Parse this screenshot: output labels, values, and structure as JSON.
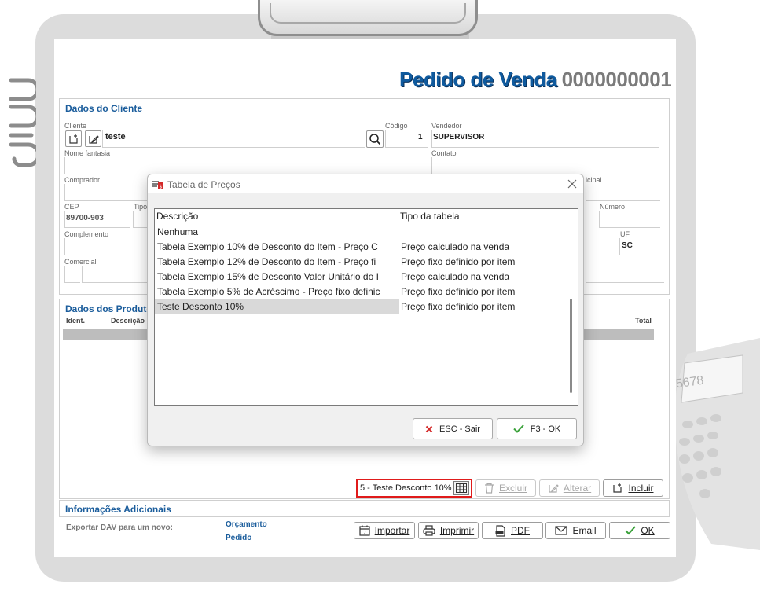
{
  "header": {
    "title": "Pedido de Venda",
    "order_number": "0000000001"
  },
  "cliente_section": {
    "title": "Dados do Cliente",
    "labels": {
      "cliente": "Cliente",
      "codigo": "Código",
      "vendedor": "Vendedor",
      "nome_fantasia": "Nome fantasia",
      "contato": "Contato",
      "comprador": "Comprador",
      "municipal": "icipal",
      "cep": "CEP",
      "tipo": "Tipo",
      "numero": "Número",
      "complemento": "Complemento",
      "uf": "UF",
      "comercial": "Comercial"
    },
    "values": {
      "cliente": "teste",
      "codigo": "1",
      "vendedor": "SUPERVISOR",
      "cep": "89700-903",
      "uf": "SC"
    }
  },
  "produtos_section": {
    "title": "Dados dos Produto",
    "columns": {
      "ident": "Ident.",
      "descricao": "Descrição",
      "total": "Total"
    }
  },
  "product_toolbar": {
    "selected_table": "5 - Teste Desconto 10%",
    "excluir": "Excluir",
    "alterar": "Alterar",
    "incluir": "Incluir"
  },
  "info_section": {
    "title": "Informações Adicionais",
    "export_label": "Exportar DAV para um novo:",
    "orcamento": "Orçamento",
    "pedido": "Pedido"
  },
  "footer_buttons": {
    "importar": "Importar",
    "imprimir": "Imprimir",
    "pdf": "PDF",
    "email": "Email",
    "ok": "OK"
  },
  "dialog": {
    "title": "Tabela de Preços",
    "columns": {
      "descricao": "Descrição",
      "tipo": "Tipo da tabela"
    },
    "rows": [
      {
        "descricao": "Nenhuma",
        "tipo": ""
      },
      {
        "descricao": "Tabela Exemplo 10% de Desconto do Item - Preço C",
        "tipo": "Preço calculado na venda"
      },
      {
        "descricao": "Tabela Exemplo 12% de Desconto do Item - Preço fi",
        "tipo": "Preço fixo definido por item"
      },
      {
        "descricao": "Tabela Exemplo 15% de Desconto Valor Unitário do I",
        "tipo": "Preço calculado na venda"
      },
      {
        "descricao": "Tabela Exemplo 5% de Acréscimo - Preço fixo definic",
        "tipo": "Preço fixo definido por item"
      },
      {
        "descricao": "Teste Desconto 10%",
        "tipo": "Preço fixo definido por item"
      }
    ],
    "selected_row": 5,
    "esc_label": "ESC - Sair",
    "ok_label": "F3 - OK"
  },
  "calculator_display": "5678",
  "colors": {
    "title_blue": "#0f5a9e",
    "section_blue": "#1b5d9c",
    "highlight_red": "#e01b1b",
    "ok_green": "#3aa13a",
    "cancel_red": "#d42a2a"
  }
}
